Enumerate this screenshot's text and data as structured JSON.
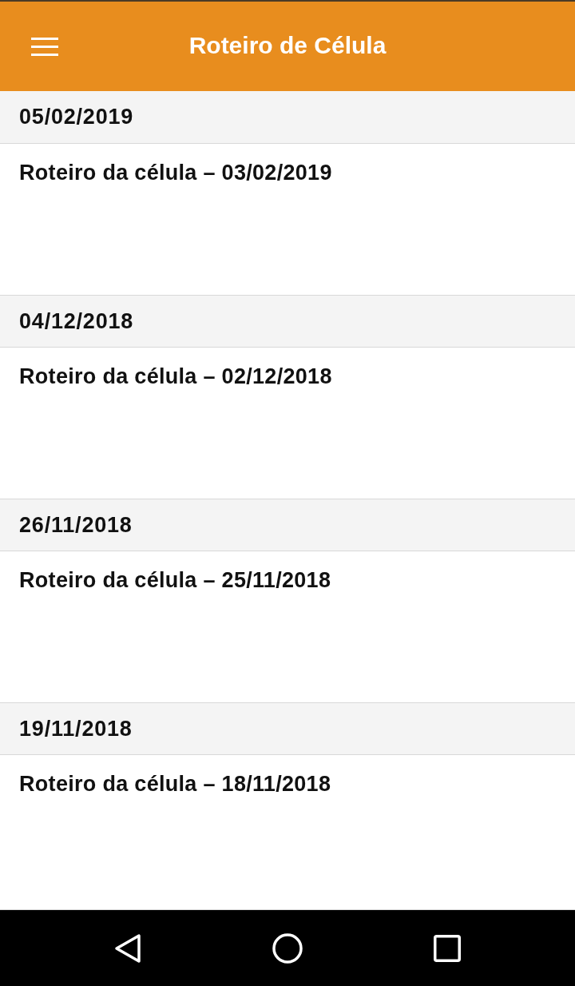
{
  "app_bar": {
    "title": "Roteiro de Célula"
  },
  "sections": [
    {
      "date": "05/02/2019",
      "entries": [
        {
          "title": "Roteiro da célula – 03/02/2019"
        }
      ]
    },
    {
      "date": "04/12/2018",
      "entries": [
        {
          "title": "Roteiro da célula – 02/12/2018"
        }
      ]
    },
    {
      "date": "26/11/2018",
      "entries": [
        {
          "title": "Roteiro da célula – 25/11/2018"
        }
      ]
    },
    {
      "date": "19/11/2018",
      "entries": [
        {
          "title": "Roteiro da célula – 18/11/2018"
        }
      ]
    }
  ]
}
